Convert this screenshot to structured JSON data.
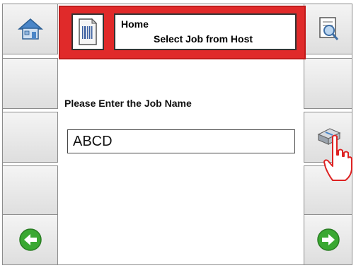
{
  "header": {
    "title": "Home",
    "subtitle": "Select Job from Host"
  },
  "main": {
    "prompt": "Please Enter the Job Name",
    "job_name_value": "ABCD"
  },
  "icons": {
    "home": "home-icon",
    "barcode": "barcode-document-icon",
    "search": "search-document-icon",
    "keyboard": "keyboard-key-icon",
    "back": "arrow-left-icon",
    "next": "arrow-right-icon",
    "pointer": "hand-pointer-icon"
  },
  "colors": {
    "header_red": "#e02a2a",
    "nav_green": "#3aa832"
  }
}
